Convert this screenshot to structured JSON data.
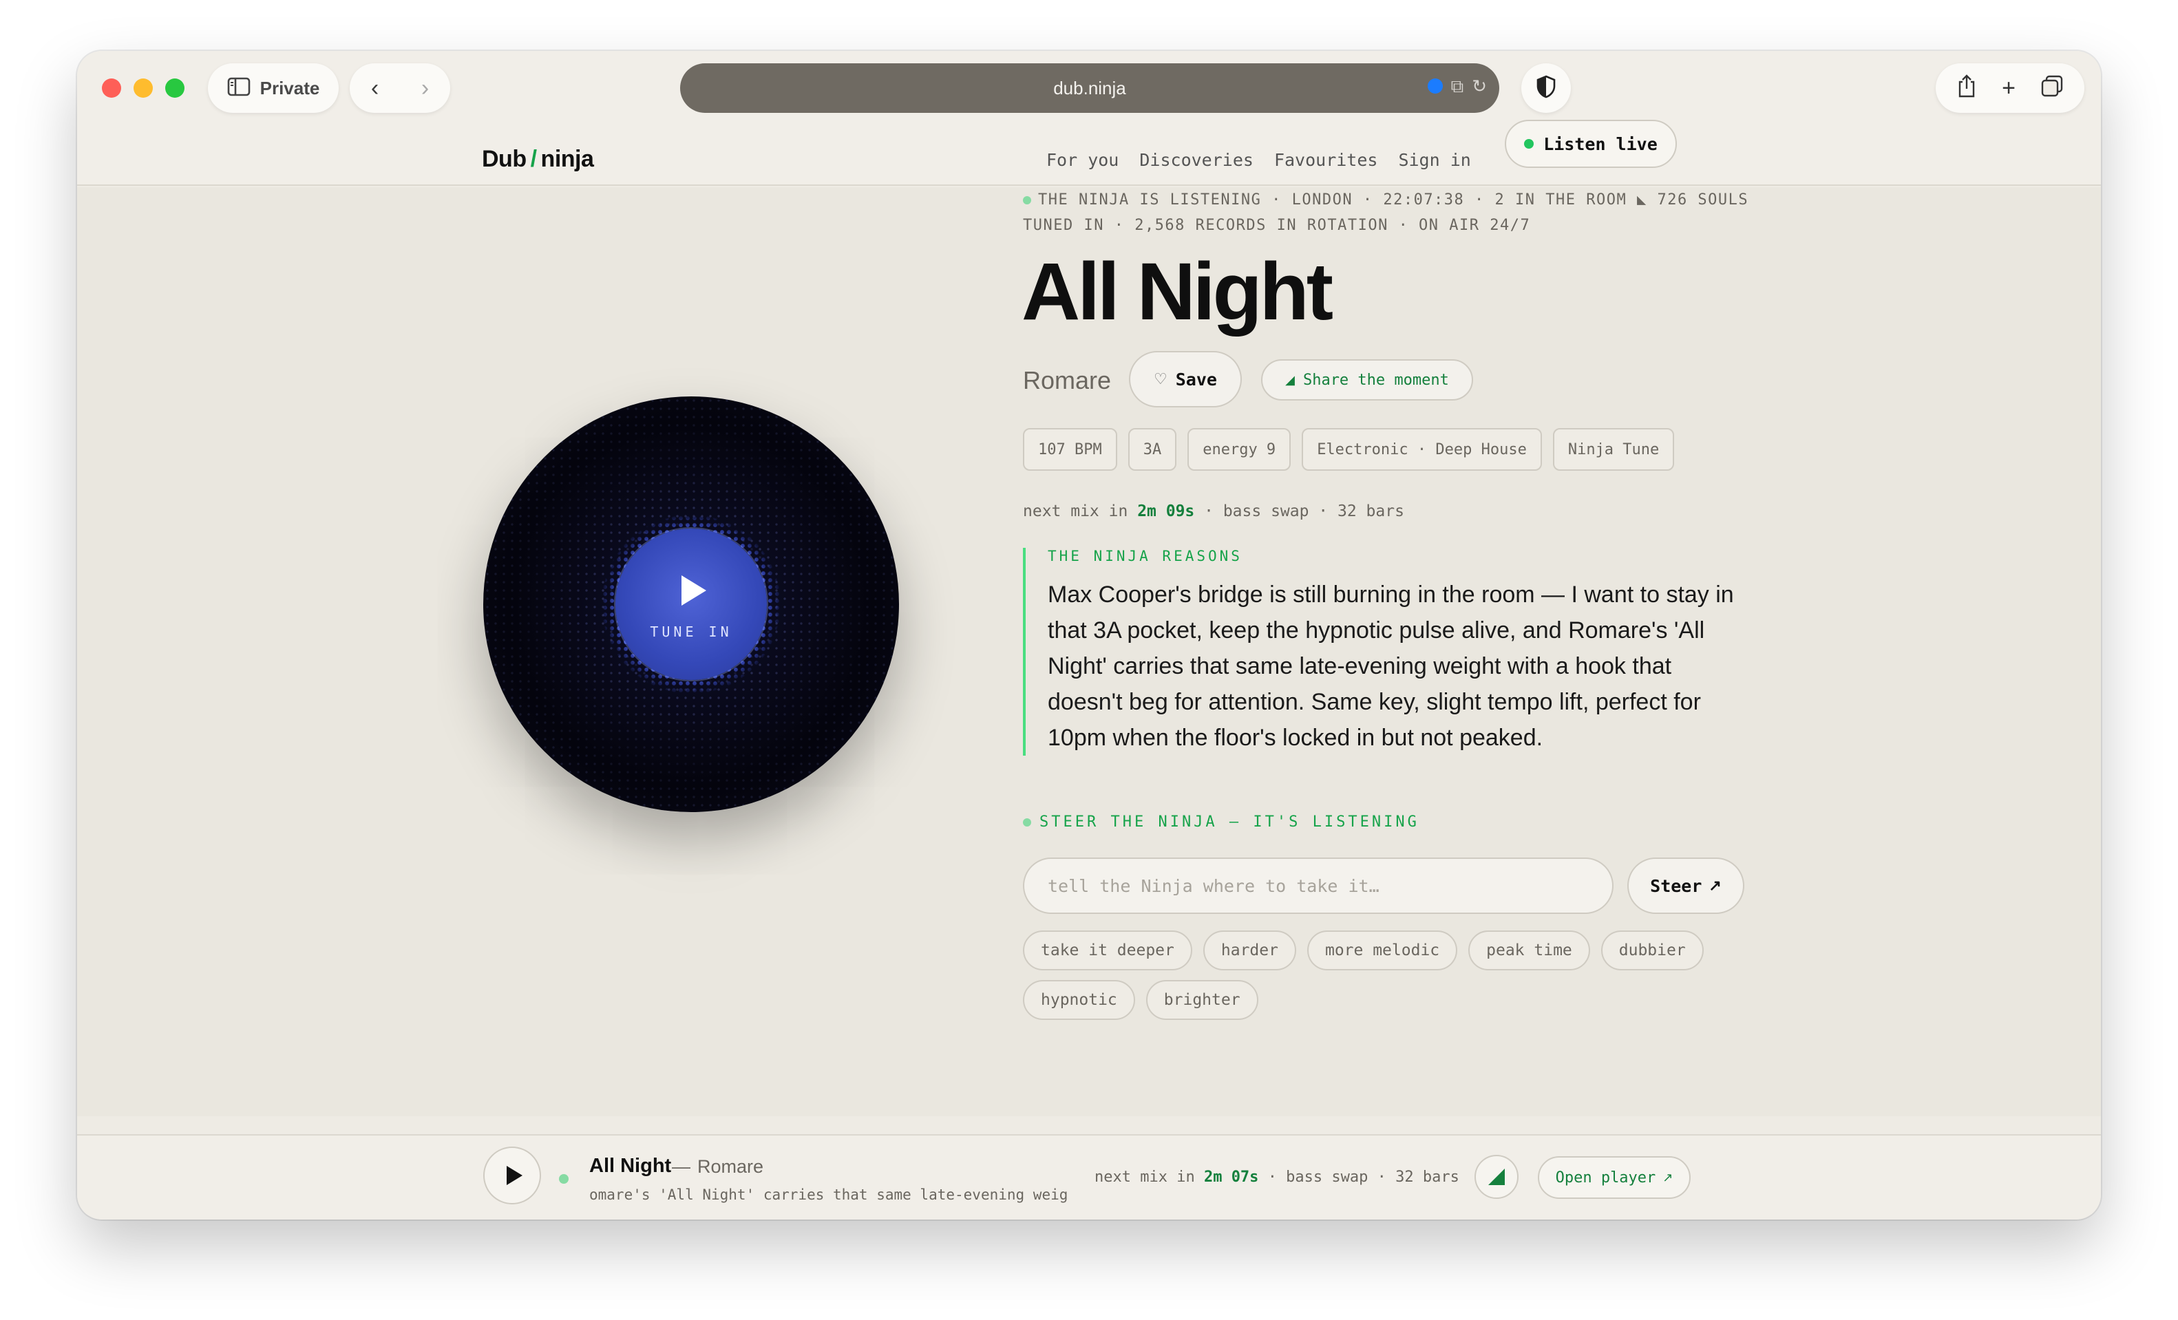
{
  "browser": {
    "private_label": "Private",
    "url": "dub.ninja"
  },
  "site": {
    "logo_left": "Dub",
    "logo_slash": "/",
    "logo_right": "ninja",
    "nav": [
      "For you",
      "Discoveries",
      "Favourites",
      "Sign in"
    ],
    "listen_live_label": "Listen live"
  },
  "status": {
    "line": "THE NINJA IS LISTENING · LONDON · 22:07:38 · 2 IN THE ROOM ◣ 726 SOULS TUNED IN · 2,568 RECORDS IN ROTATION · ON AIR 24/7"
  },
  "track": {
    "title": "All Night",
    "artist": "Romare",
    "save_label": "Save",
    "share_label": "Share the moment",
    "tags": [
      "107 BPM",
      "3A",
      "energy 9",
      "Electronic · Deep House",
      "Ninja Tune"
    ]
  },
  "next_mix": {
    "prefix": "next mix in",
    "countdown": "2m 09s",
    "suffix": "· bass swap · 32 bars"
  },
  "disc": {
    "tune_in_label": "TUNE IN"
  },
  "reasons": {
    "heading": "THE NINJA REASONS",
    "body": "Max Cooper's bridge is still burning in the room — I want to stay in that 3A pocket, keep the hypnotic pulse alive, and Romare's 'All Night' carries that same late-evening weight with a hook that doesn't beg for attention. Same key, slight tempo lift, perfect for 10pm when the floor's locked in but not peaked."
  },
  "steer": {
    "heading": "STEER THE NINJA — IT'S LISTENING",
    "placeholder": "tell the Ninja where to take it…",
    "button_label": "Steer",
    "chips": [
      "take it deeper",
      "harder",
      "more melodic",
      "peak time",
      "dubbier",
      "hypnotic",
      "brighter"
    ]
  },
  "player": {
    "title": "All Night",
    "artist": "Romare",
    "ticker": "omare's 'All Night' carries that same late-evening weig",
    "next_prefix": "next mix in",
    "next_countdown": "2m 07s",
    "next_suffix": "· bass swap · 32 bars",
    "open_label": "Open player"
  },
  "colors": {
    "accent": "#16a34a",
    "live": "#22c55e",
    "disc_core": "#3448b8",
    "background": "#eae7df"
  }
}
